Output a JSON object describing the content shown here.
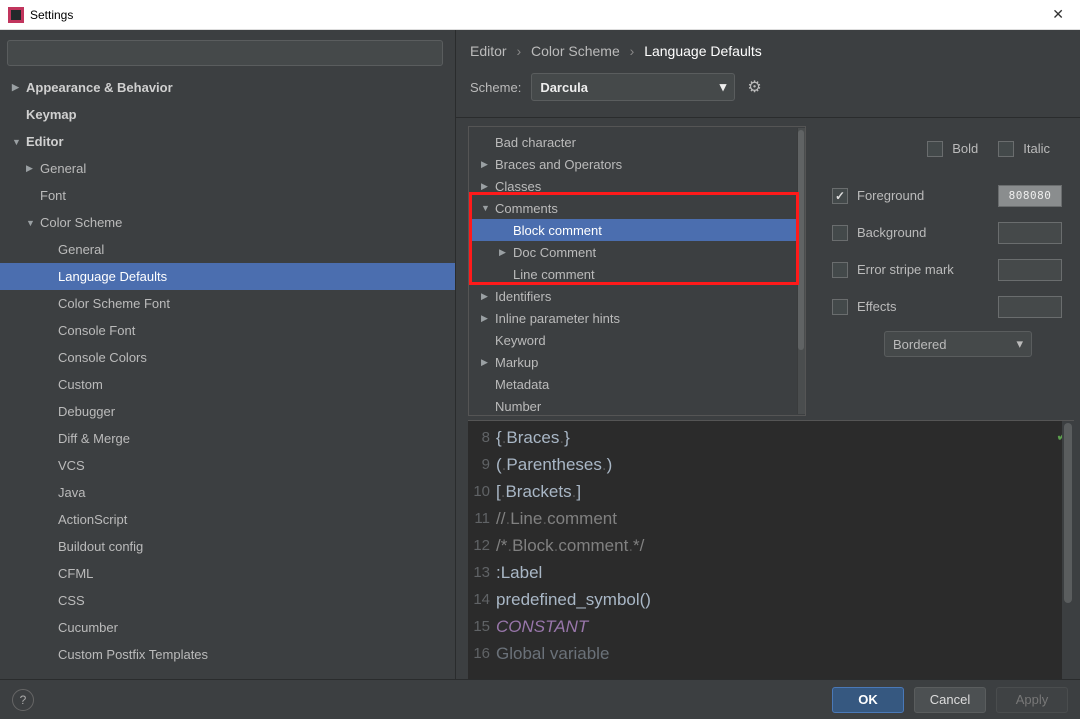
{
  "window": {
    "title": "Settings"
  },
  "breadcrumb": {
    "p0": "Editor",
    "p1": "Color Scheme",
    "p2": "Language Defaults"
  },
  "scheme": {
    "label": "Scheme:",
    "value": "Darcula"
  },
  "sidebar": {
    "items": [
      {
        "label": "Appearance & Behavior",
        "bold": true,
        "indent": 0,
        "tri": "▶"
      },
      {
        "label": "Keymap",
        "bold": true,
        "indent": 0,
        "tri": ""
      },
      {
        "label": "Editor",
        "bold": true,
        "indent": 0,
        "tri": "▼"
      },
      {
        "label": "General",
        "indent": 1,
        "tri": "▶"
      },
      {
        "label": "Font",
        "indent": 1,
        "tri": ""
      },
      {
        "label": "Color Scheme",
        "indent": 1,
        "tri": "▼"
      },
      {
        "label": "General",
        "indent": 2,
        "tri": ""
      },
      {
        "label": "Language Defaults",
        "indent": 2,
        "tri": "",
        "selected": true
      },
      {
        "label": "Color Scheme Font",
        "indent": 2,
        "tri": ""
      },
      {
        "label": "Console Font",
        "indent": 2,
        "tri": ""
      },
      {
        "label": "Console Colors",
        "indent": 2,
        "tri": ""
      },
      {
        "label": "Custom",
        "indent": 2,
        "tri": ""
      },
      {
        "label": "Debugger",
        "indent": 2,
        "tri": ""
      },
      {
        "label": "Diff & Merge",
        "indent": 2,
        "tri": ""
      },
      {
        "label": "VCS",
        "indent": 2,
        "tri": ""
      },
      {
        "label": "Java",
        "indent": 2,
        "tri": ""
      },
      {
        "label": "ActionScript",
        "indent": 2,
        "tri": ""
      },
      {
        "label": "Buildout config",
        "indent": 2,
        "tri": ""
      },
      {
        "label": "CFML",
        "indent": 2,
        "tri": ""
      },
      {
        "label": "CSS",
        "indent": 2,
        "tri": ""
      },
      {
        "label": "Cucumber",
        "indent": 2,
        "tri": ""
      },
      {
        "label": "Custom Postfix Templates",
        "indent": 2,
        "tri": ""
      }
    ]
  },
  "attributes": {
    "items": [
      {
        "label": "Bad character",
        "indent": 1,
        "tri": ""
      },
      {
        "label": "Braces and Operators",
        "indent": 1,
        "tri": "▶"
      },
      {
        "label": "Classes",
        "indent": 1,
        "tri": "▶"
      },
      {
        "label": "Comments",
        "indent": 1,
        "tri": "▼"
      },
      {
        "label": "Block comment",
        "indent": 2,
        "tri": "",
        "selected": true
      },
      {
        "label": "Doc Comment",
        "indent": 2,
        "tri": "▶"
      },
      {
        "label": "Line comment",
        "indent": 2,
        "tri": ""
      },
      {
        "label": "Identifiers",
        "indent": 1,
        "tri": "▶"
      },
      {
        "label": "Inline parameter hints",
        "indent": 1,
        "tri": "▶"
      },
      {
        "label": "Keyword",
        "indent": 1,
        "tri": ""
      },
      {
        "label": "Markup",
        "indent": 1,
        "tri": "▶"
      },
      {
        "label": "Metadata",
        "indent": 1,
        "tri": ""
      },
      {
        "label": "Number",
        "indent": 1,
        "tri": ""
      }
    ]
  },
  "style": {
    "bold_label": "Bold",
    "italic_label": "Italic",
    "foreground_label": "Foreground",
    "foreground_value": "808080",
    "foreground_checked": true,
    "background_label": "Background",
    "background_checked": false,
    "error_stripe_label": "Error stripe mark",
    "error_stripe_checked": false,
    "effects_label": "Effects",
    "effects_checked": false,
    "effects_type": "Bordered"
  },
  "preview": {
    "lines": [
      {
        "n": "8",
        "html": "{<span class='dot'>.</span>Braces<span class='dot'>.</span>}"
      },
      {
        "n": "9",
        "html": "(<span class='dot'>.</span>Parentheses<span class='dot'>.</span>)"
      },
      {
        "n": "10",
        "html": "[<span class='dot'>.</span>Brackets<span class='dot'>.</span>]"
      },
      {
        "n": "11",
        "html": "<span class='gray'>//<span class='dot'>.</span>Line<span class='dot'>.</span>comment</span>"
      },
      {
        "n": "12",
        "html": "<span class='gray'>/*<span class='dot'>.</span>Block<span class='dot'>.</span>comment<span class='dot'>.</span>*/</span>"
      },
      {
        "n": "13",
        "html": ":Label"
      },
      {
        "n": "14",
        "html": "predefined_symbol()"
      },
      {
        "n": "15",
        "html": "<span class='const'>CONSTANT</span>"
      },
      {
        "n": "16",
        "html": "<span style='opacity:.5'>Global variable</span>"
      }
    ]
  },
  "footer": {
    "ok": "OK",
    "cancel": "Cancel",
    "apply": "Apply"
  }
}
